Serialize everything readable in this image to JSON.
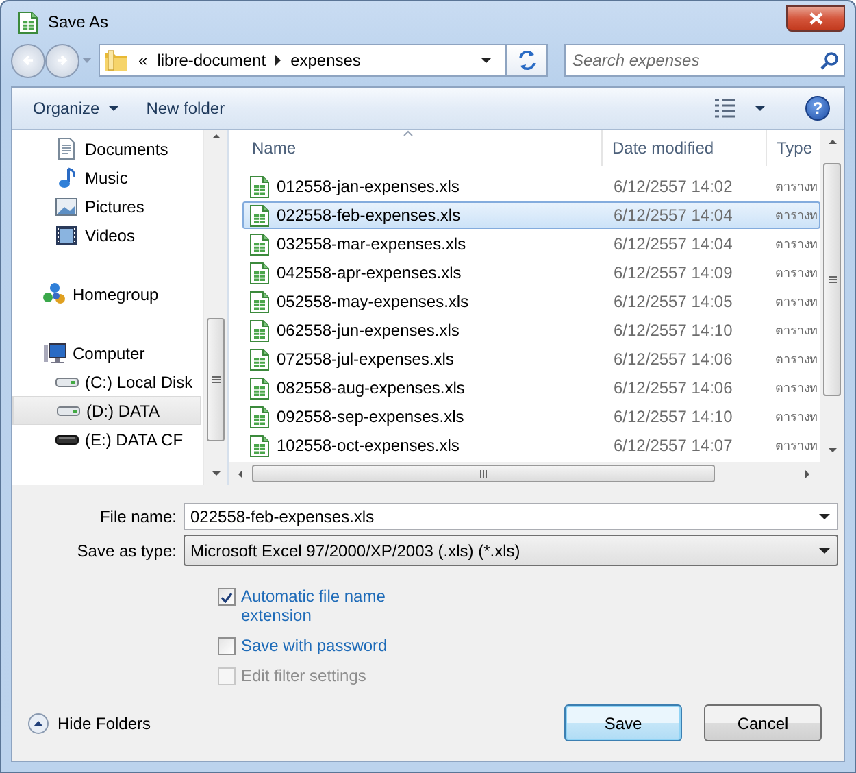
{
  "window": {
    "title": "Save As"
  },
  "address": {
    "overflow": "«",
    "crumbs": [
      "libre-document",
      "expenses"
    ]
  },
  "search": {
    "placeholder": "Search expenses"
  },
  "toolbar": {
    "organize": "Organize",
    "new_folder": "New folder",
    "help": "?"
  },
  "nav": {
    "items": [
      {
        "label": "Documents",
        "kind": "documents",
        "selected": false
      },
      {
        "label": "Music",
        "kind": "music",
        "selected": false
      },
      {
        "label": "Pictures",
        "kind": "pictures",
        "selected": false
      },
      {
        "label": "Videos",
        "kind": "videos",
        "selected": false
      },
      {
        "label": "Homegroup",
        "kind": "homegroup",
        "selected": false
      },
      {
        "label": "Computer",
        "kind": "computer",
        "selected": false,
        "children": [
          {
            "label": "(C:) Local Disk",
            "kind": "drive",
            "selected": false
          },
          {
            "label": "(D:) DATA",
            "kind": "drive",
            "selected": true
          },
          {
            "label": "(E:) DATA CF",
            "kind": "removable",
            "selected": false
          }
        ]
      }
    ]
  },
  "files": {
    "columns": [
      {
        "label": "Name",
        "sorted": true
      },
      {
        "label": "Date modified",
        "sorted": false
      },
      {
        "label": "Type",
        "sorted": false
      }
    ],
    "rows": [
      {
        "name": "012558-jan-expenses.xls",
        "date": "6/12/2557 14:02",
        "type": "ตารางท",
        "selected": false
      },
      {
        "name": "022558-feb-expenses.xls",
        "date": "6/12/2557 14:04",
        "type": "ตารางท",
        "selected": true
      },
      {
        "name": "032558-mar-expenses.xls",
        "date": "6/12/2557 14:04",
        "type": "ตารางท",
        "selected": false
      },
      {
        "name": "042558-apr-expenses.xls",
        "date": "6/12/2557 14:09",
        "type": "ตารางท",
        "selected": false
      },
      {
        "name": "052558-may-expenses.xls",
        "date": "6/12/2557 14:05",
        "type": "ตารางท",
        "selected": false
      },
      {
        "name": "062558-jun-expenses.xls",
        "date": "6/12/2557 14:10",
        "type": "ตารางท",
        "selected": false
      },
      {
        "name": "072558-jul-expenses.xls",
        "date": "6/12/2557 14:06",
        "type": "ตารางท",
        "selected": false
      },
      {
        "name": "082558-aug-expenses.xls",
        "date": "6/12/2557 14:06",
        "type": "ตารางท",
        "selected": false
      },
      {
        "name": "092558-sep-expenses.xls",
        "date": "6/12/2557 14:10",
        "type": "ตารางท",
        "selected": false
      },
      {
        "name": "102558-oct-expenses.xls",
        "date": "6/12/2557 14:07",
        "type": "ตารางท",
        "selected": false
      }
    ]
  },
  "form": {
    "file_name": {
      "label": "File name:",
      "value": "022558-feb-expenses.xls"
    },
    "save_as_type": {
      "label": "Save as type:",
      "value": "Microsoft Excel 97/2000/XP/2003 (.xls) (*.xls)"
    },
    "options": [
      {
        "label": "Automatic file name extension",
        "checked": true,
        "disabled": false
      },
      {
        "label": "Save with password",
        "checked": false,
        "disabled": false
      },
      {
        "label": "Edit filter settings",
        "checked": false,
        "disabled": true
      }
    ]
  },
  "hide_folders": "Hide Folders",
  "buttons": [
    {
      "label": "Save",
      "default": true
    },
    {
      "label": "Cancel",
      "default": false
    }
  ]
}
